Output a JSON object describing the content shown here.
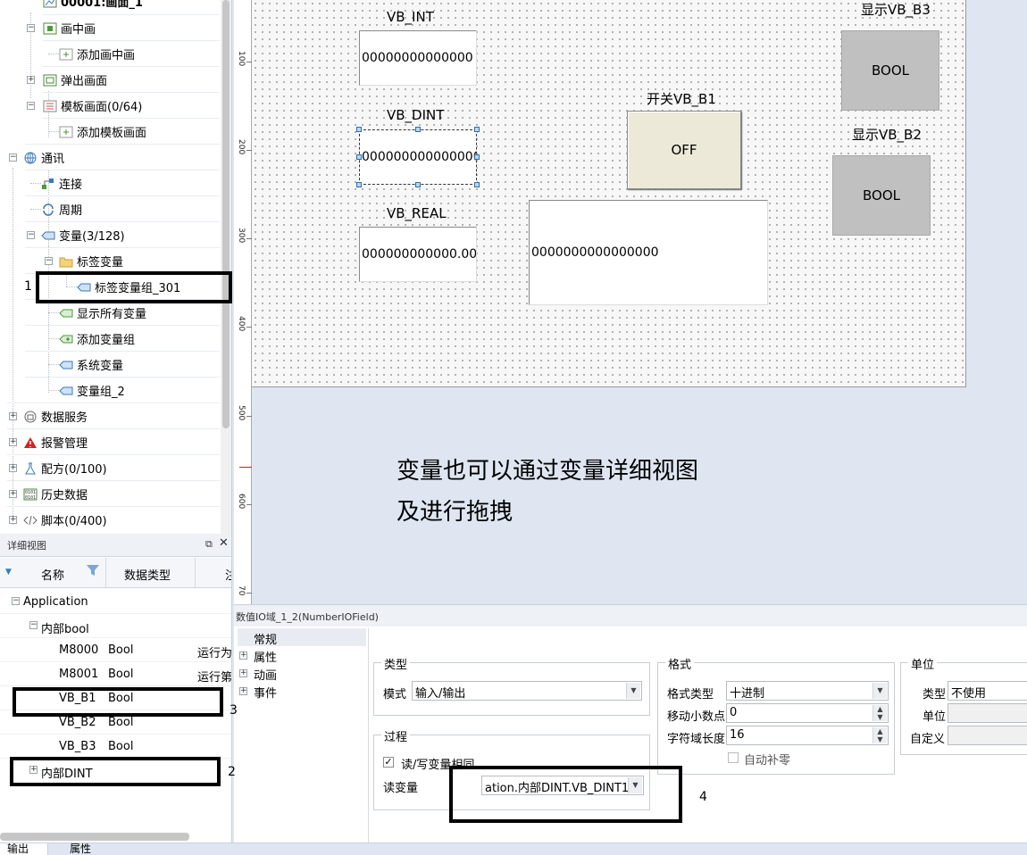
{
  "tree": {
    "items": [
      {
        "label": "00001:画面_1",
        "icon": "screen-icon"
      },
      {
        "label": "画中画",
        "icon": "pip-icon"
      },
      {
        "label": "添加画中画",
        "icon": "add-icon"
      },
      {
        "label": "弹出画面",
        "icon": "popup-icon"
      },
      {
        "label": "模板画面(0/64)",
        "icon": "template-icon"
      },
      {
        "label": "添加模板画面",
        "icon": "add-icon"
      },
      {
        "label": "通讯",
        "icon": "globe-icon"
      },
      {
        "label": "连接",
        "icon": "connection-icon"
      },
      {
        "label": "周期",
        "icon": "cycle-icon"
      },
      {
        "label": "变量(3/128)",
        "icon": "variable-icon"
      },
      {
        "label": "标签变量",
        "icon": "folder-icon"
      },
      {
        "label": "标签变量组_301",
        "icon": "tag-icon"
      },
      {
        "label": "显示所有变量",
        "icon": "show-vars-icon"
      },
      {
        "label": "添加变量组",
        "icon": "add-group-icon"
      },
      {
        "label": "系统变量",
        "icon": "system-var-icon"
      },
      {
        "label": "变量组_2",
        "icon": "var-group-icon"
      },
      {
        "label": "数据服务",
        "icon": "data-service-icon"
      },
      {
        "label": "报警管理",
        "icon": "alarm-icon"
      },
      {
        "label": "配方(0/100)",
        "icon": "recipe-icon"
      },
      {
        "label": "历史数据",
        "icon": "history-icon"
      },
      {
        "label": "脚本(0/400)",
        "icon": "script-icon"
      }
    ]
  },
  "detail": {
    "title": "详细视图",
    "columns": [
      "名称",
      "数据类型",
      "注"
    ],
    "root": "Application",
    "group_bool": "内部bool",
    "rows": [
      {
        "name": "M8000",
        "type": "Bool",
        "comment": "运行为"
      },
      {
        "name": "M8001",
        "type": "Bool",
        "comment": "运行第"
      },
      {
        "name": "VB_B1",
        "type": "Bool",
        "comment": ""
      },
      {
        "name": "VB_B2",
        "type": "Bool",
        "comment": ""
      },
      {
        "name": "VB_B3",
        "type": "Bool",
        "comment": ""
      }
    ],
    "group_dint": "内部DINT"
  },
  "ruler": {
    "labels": [
      "100",
      "200",
      "300",
      "400",
      "500",
      "600",
      "70"
    ]
  },
  "screen": {
    "vb_int_caption": "VB_INT",
    "vb_int_value": "00000000000000",
    "vb_dint_caption": "VB_DINT",
    "vb_dint_value": "000000000000000",
    "vb_real_caption": "VB_REAL",
    "vb_real_value": "000000000000.00",
    "switch_caption": "开关VB_B1",
    "switch_state": "OFF",
    "big_field_value": "0000000000000000",
    "b3_caption": "显示VB_B3",
    "b3_value": "BOOL",
    "b2_caption": "显示VB_B2",
    "b2_value": "BOOL"
  },
  "note": {
    "line1": "变量也可以通过变量详细视图",
    "line2": "及进行拖拽"
  },
  "props": {
    "title": "数值IO域_1_2(NumberIOField)",
    "nav": [
      "常规",
      "属性",
      "动画",
      "事件"
    ],
    "type_group": "类型",
    "mode_label": "模式",
    "mode_value": "输入/输出",
    "process_group": "过程",
    "rw_same_label": "读/写变量相同",
    "rw_same_checked": true,
    "read_var_label": "读变量",
    "read_var_value": "ation.内部DINT.VB_DINT1",
    "format_group": "格式",
    "format_type_label": "格式类型",
    "format_type_value": "十进制",
    "decimal_shift_label": "移动小数点",
    "decimal_shift_value": "0",
    "field_length_label": "字符域长度",
    "field_length_value": "16",
    "auto_pad_label": "自动补零",
    "auto_pad_checked": false,
    "unit_group": "单位",
    "unit_type_label": "类型",
    "unit_type_value": "不使用",
    "unit_label": "单位",
    "custom_label": "自定义"
  },
  "bottom_tabs": [
    "输出",
    "属性"
  ],
  "annotations": [
    "1",
    "2",
    "3",
    "4"
  ]
}
